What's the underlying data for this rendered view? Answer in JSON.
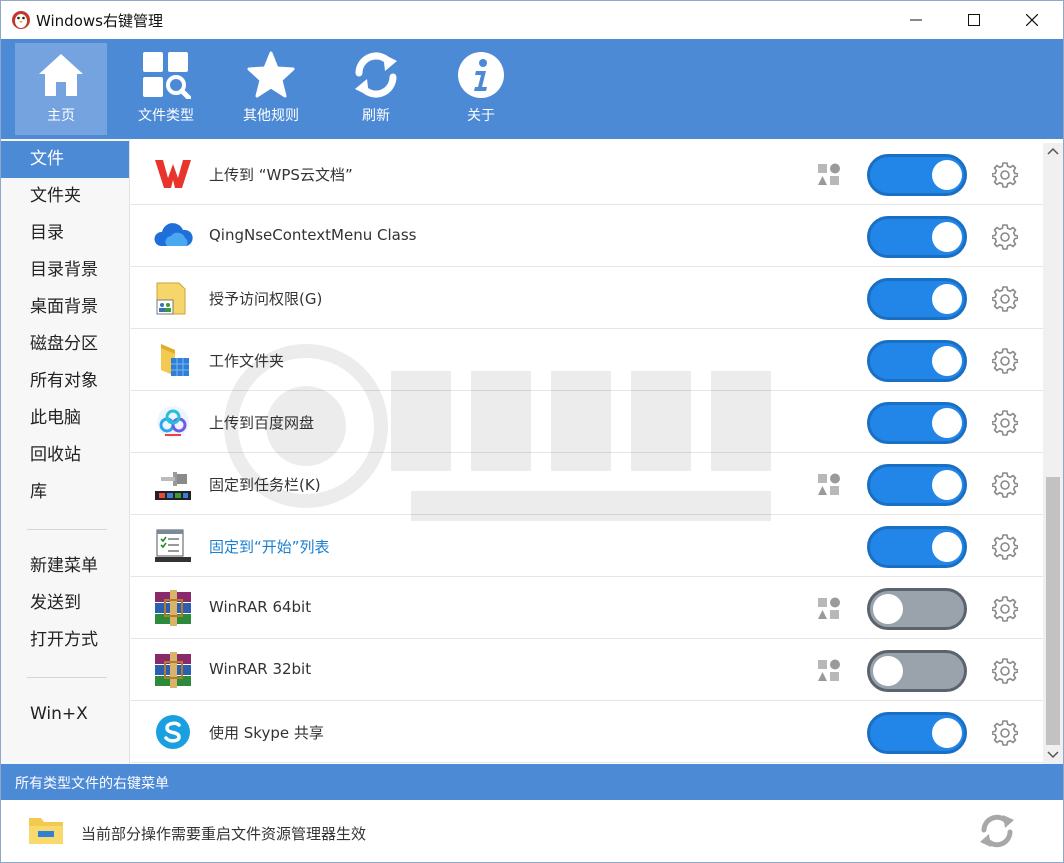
{
  "window": {
    "title": "Windows右键管理"
  },
  "toolbar": {
    "items": [
      {
        "label": "主页",
        "icon": "home-icon"
      },
      {
        "label": "文件类型",
        "icon": "file-types-icon"
      },
      {
        "label": "其他规则",
        "icon": "star-icon"
      },
      {
        "label": "刷新",
        "icon": "refresh-icon"
      },
      {
        "label": "关于",
        "icon": "info-icon"
      }
    ],
    "active_index": 0
  },
  "sidebar": {
    "items": [
      "文件",
      "文件夹",
      "目录",
      "目录背景",
      "桌面背景",
      "磁盘分区",
      "所有对象",
      "此电脑",
      "回收站",
      "库"
    ],
    "extra_items": [
      "新建菜单",
      "发送到",
      "打开方式"
    ],
    "winx_item": "Win+X",
    "active_index": 0
  },
  "list": {
    "rows": [
      {
        "label": "上传到 “WPS云文档”",
        "icon": "wps-icon",
        "enabled": true,
        "has_category_icon": true
      },
      {
        "label": "QingNseContextMenu Class",
        "icon": "cloud-icon",
        "enabled": true,
        "has_category_icon": false
      },
      {
        "label": "授予访问权限(G)",
        "icon": "share-access-icon",
        "enabled": true,
        "has_category_icon": false
      },
      {
        "label": "工作文件夹",
        "icon": "work-folder-icon",
        "enabled": true,
        "has_category_icon": false
      },
      {
        "label": "上传到百度网盘",
        "icon": "baidu-netdisk-icon",
        "enabled": true,
        "has_category_icon": false
      },
      {
        "label": "固定到任务栏(K)",
        "icon": "pin-taskbar-icon",
        "enabled": true,
        "has_category_icon": true
      },
      {
        "label": "固定到“开始”列表",
        "icon": "pin-start-icon",
        "enabled": true,
        "has_category_icon": false,
        "link": true
      },
      {
        "label": "WinRAR 64bit",
        "icon": "winrar-icon",
        "enabled": false,
        "has_category_icon": true
      },
      {
        "label": "WinRAR 32bit",
        "icon": "winrar-icon",
        "enabled": false,
        "has_category_icon": true
      },
      {
        "label": "使用 Skype 共享",
        "icon": "skype-icon",
        "enabled": true,
        "has_category_icon": false
      }
    ]
  },
  "status": {
    "text": "所有类型文件的右键菜单"
  },
  "footer": {
    "text": "当前部分操作需要重启文件资源管理器生效",
    "icon": "explorer-folder-icon"
  },
  "colors": {
    "accent": "#4d8ad6",
    "toggle_on": "#2186e8",
    "toggle_off": "#9aa3ab"
  }
}
